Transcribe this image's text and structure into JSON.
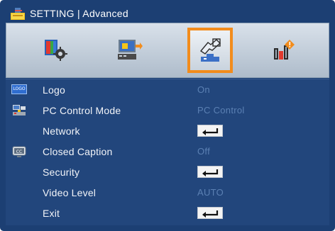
{
  "window": {
    "title": "SETTING | Advanced"
  },
  "tabs": [
    {
      "name": "image-settings",
      "icon": "image-settings-icon",
      "active": false
    },
    {
      "name": "display-settings",
      "icon": "display-settings-icon",
      "active": false
    },
    {
      "name": "setup-settings",
      "icon": "setup-hand-icon",
      "active": true
    },
    {
      "name": "options-settings",
      "icon": "options-icon",
      "active": false
    }
  ],
  "menu": {
    "items": [
      {
        "label": "Logo",
        "value": "On",
        "icon": "logo-icon",
        "action": "value"
      },
      {
        "label": "PC Control Mode",
        "value": "PC Control",
        "icon": "pc-control-icon",
        "action": "value"
      },
      {
        "label": "Network",
        "value": "",
        "icon": "",
        "action": "enter-key"
      },
      {
        "label": "Closed Caption",
        "value": "Off",
        "icon": "closed-caption-icon",
        "action": "value"
      },
      {
        "label": "Security",
        "value": "",
        "icon": "",
        "action": "enter-key"
      },
      {
        "label": "Video Level",
        "value": "AUTO",
        "icon": "",
        "action": "value"
      },
      {
        "label": "Exit",
        "value": "",
        "icon": "",
        "action": "enter-key"
      }
    ]
  },
  "logo_badge_text": "LOGO",
  "colors": {
    "osd_border": "#1c3f73",
    "menu_bg": "#22467c",
    "active_tab_outline": "#f28c1c",
    "value_text": "#5b80b3",
    "label_text": "#f2f4f8"
  }
}
